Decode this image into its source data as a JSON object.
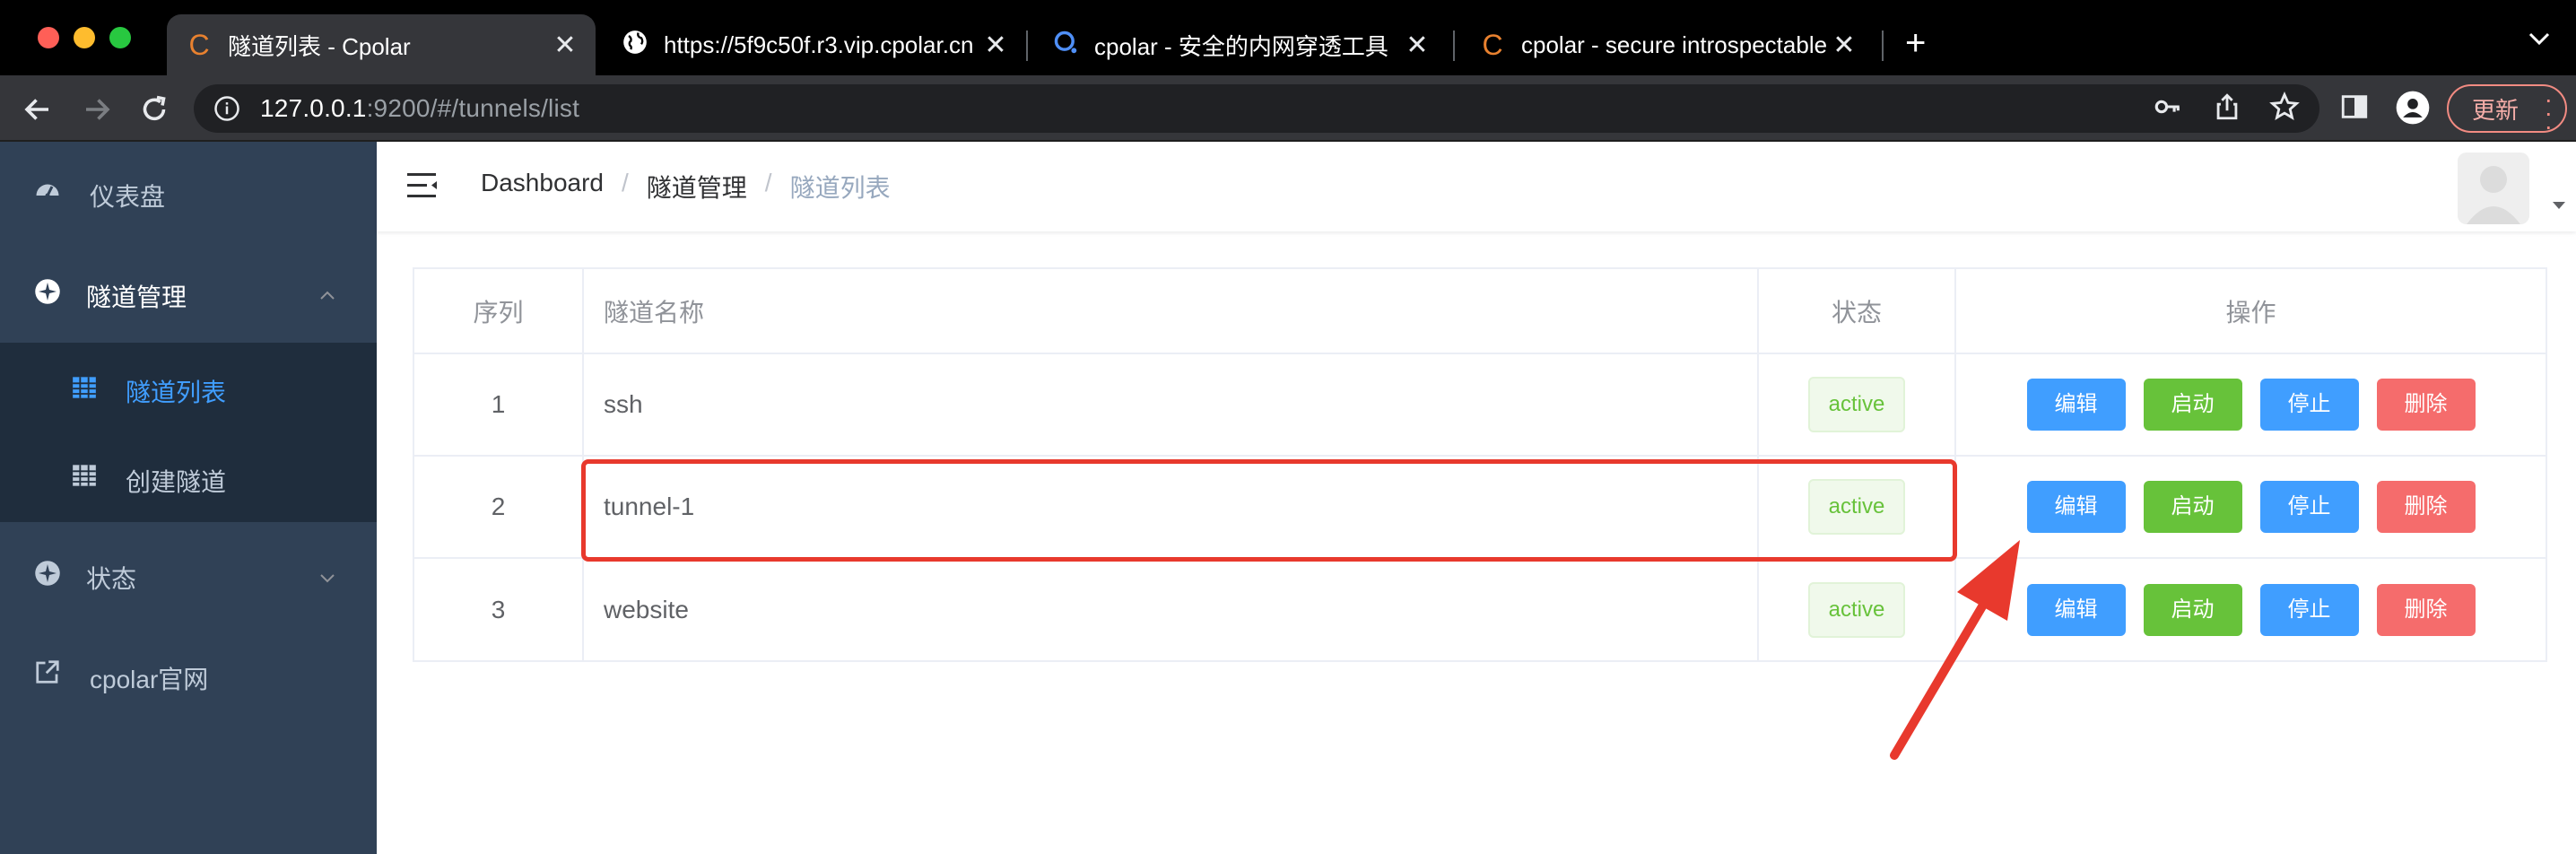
{
  "browser": {
    "tabs": [
      {
        "title": "隧道列表 - Cpolar",
        "favicon": "cpolar-c-icon",
        "active": true
      },
      {
        "title": "https://5f9c50f.r3.vip.cpolar.cn",
        "favicon": "globe-icon",
        "active": false
      },
      {
        "title": "cpolar - 安全的内网穿透工具",
        "favicon": "cpolar-q-icon",
        "active": false
      },
      {
        "title": "cpolar - secure introspectable",
        "favicon": "cpolar-c-icon",
        "active": false
      }
    ],
    "address": {
      "host": "127.0.0.1",
      "rest": ":9200/#/tunnels/list"
    },
    "update_label": "更新"
  },
  "sidebar": {
    "items": [
      {
        "label": "仪表盘",
        "icon": "dashboard-icon"
      },
      {
        "label": "隧道管理",
        "icon": "compass-icon"
      },
      {
        "label": "隧道列表",
        "icon": "table-icon",
        "active": true
      },
      {
        "label": "创建隧道",
        "icon": "table-icon"
      },
      {
        "label": "状态",
        "icon": "compass-icon"
      },
      {
        "label": "cpolar官网",
        "icon": "external-link-icon"
      }
    ]
  },
  "breadcrumb": [
    "Dashboard",
    "隧道管理",
    "隧道列表"
  ],
  "table": {
    "headers": [
      "序列",
      "隧道名称",
      "状态",
      "操作"
    ],
    "rows": [
      {
        "index": "1",
        "name": "ssh",
        "status": "active"
      },
      {
        "index": "2",
        "name": "tunnel-1",
        "status": "active"
      },
      {
        "index": "3",
        "name": "website",
        "status": "active"
      }
    ],
    "actions": {
      "edit": "编辑",
      "start": "启动",
      "stop": "停止",
      "delete": "删除"
    }
  },
  "colors": {
    "accent": "#409eff",
    "success": "#67c23a",
    "danger": "#f56c6c",
    "sidebar": "#304156",
    "annotation": "#e8392d"
  }
}
